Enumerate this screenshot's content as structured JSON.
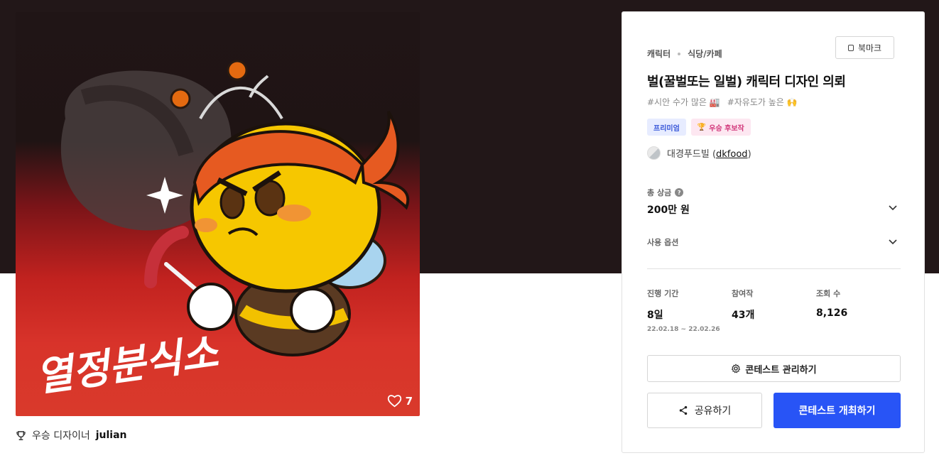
{
  "artwork": {
    "calligraphy": "열정분식소",
    "likes": "7"
  },
  "winner": {
    "label": "우승 디자이너",
    "name": "julian"
  },
  "contest": {
    "categories": [
      "캐릭터",
      "식당/카페"
    ],
    "bookmark_label": "북마크",
    "title": "벌(꿀벌또는 일벌) 캐릭터 디자인 의뢰",
    "tags": [
      "#시안 수가 많은 🏭",
      "#자유도가 높은 🙌"
    ],
    "badges": {
      "premium": "프리미엄",
      "winner": "우승 후보작"
    },
    "host": {
      "name": "대경푸드빌",
      "handle": "dkfood"
    },
    "prize": {
      "label": "총 상금",
      "value": "200만 원"
    },
    "usage_label": "사용 옵션",
    "stats": {
      "period_label": "진행 기간",
      "period_value": "8일",
      "period_dates": "22.02.18 ~ 22.02.26",
      "entries_label": "참여작",
      "entries_value": "43개",
      "views_label": "조회 수",
      "views_value": "8,126"
    },
    "manage_label": "콘테스트 관리하기",
    "share_label": "공유하기",
    "host_contest_label": "콘테스트 개최하기"
  },
  "colors": {
    "hero_bg": "#221718",
    "primary": "#2854f6"
  }
}
